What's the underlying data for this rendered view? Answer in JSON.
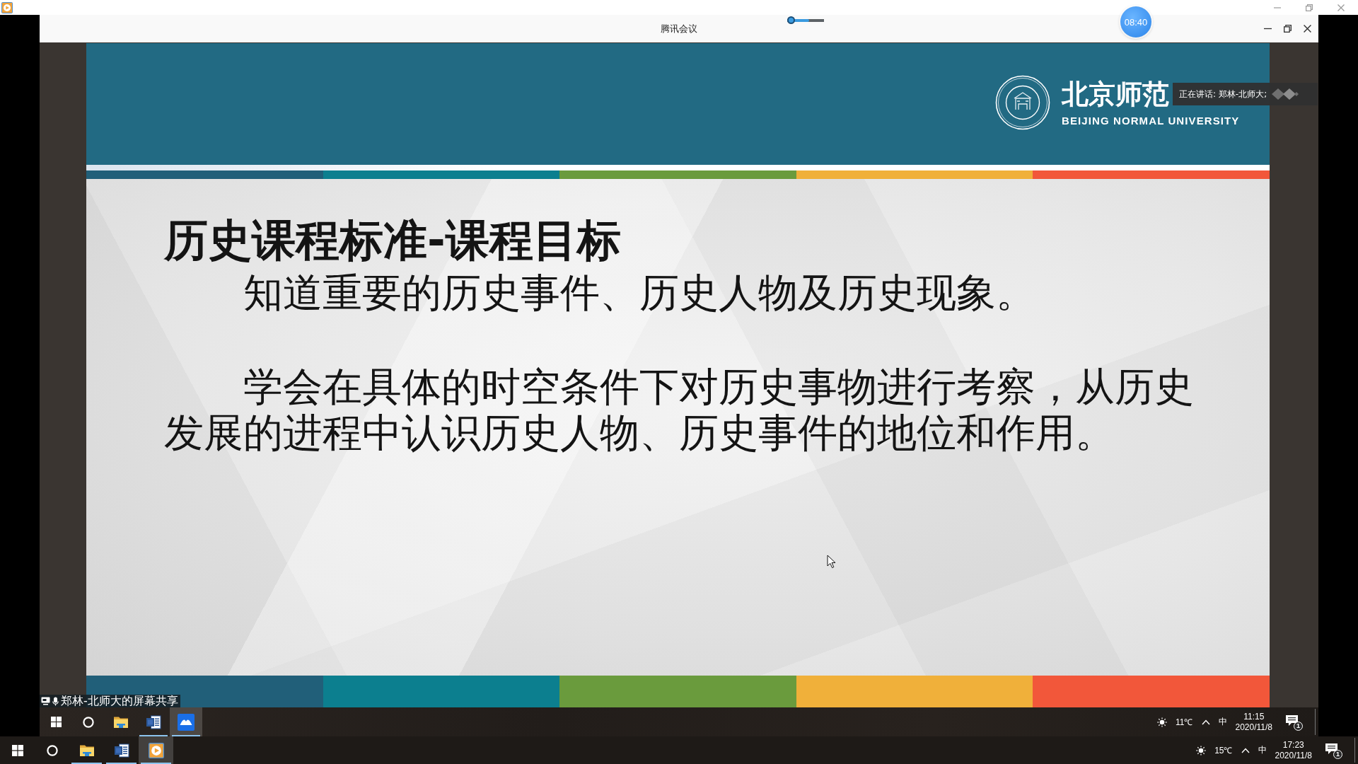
{
  "meeting_window": {
    "title": "腾讯会议",
    "slider": {
      "level": 0.6
    },
    "timer": "08:40"
  },
  "slide": {
    "logo": {
      "name_cn": "北京师范",
      "name_en": "BEIJING NORMAL UNIVERSITY"
    },
    "title": "历史课程标准-课程目标",
    "paragraphs": [
      "知道重要的历史事件、历史人物及历史现象。",
      "学会在具体的时空条件下对历史事物进行考察，从历史发展的进程中认识历史人物、历史事件的地位和作用。"
    ]
  },
  "speaker_tooltip": {
    "text": "正在讲话: 郑林-北师大;"
  },
  "share_label": {
    "text": "郑林-北师大的屏幕共享"
  },
  "shared_taskbar": {
    "apps": [
      {
        "kind": "explorer",
        "running": false,
        "selected": false
      },
      {
        "kind": "word",
        "running": true,
        "selected": false
      },
      {
        "kind": "meeting",
        "running": true,
        "selected": true
      }
    ],
    "tray": {
      "temperature": "11℃",
      "input_method": "中",
      "time": "11:15",
      "date": "2020/11/8",
      "notifications": "1"
    }
  },
  "taskbar": {
    "apps": [
      {
        "kind": "explorer",
        "running": true,
        "selected": false
      },
      {
        "kind": "word",
        "running": true,
        "selected": false
      },
      {
        "kind": "player",
        "running": true,
        "selected": true
      }
    ],
    "tray": {
      "temperature": "15℃",
      "input_method": "中",
      "time": "17:23",
      "date": "2020/11/8",
      "notifications": "1"
    }
  }
}
